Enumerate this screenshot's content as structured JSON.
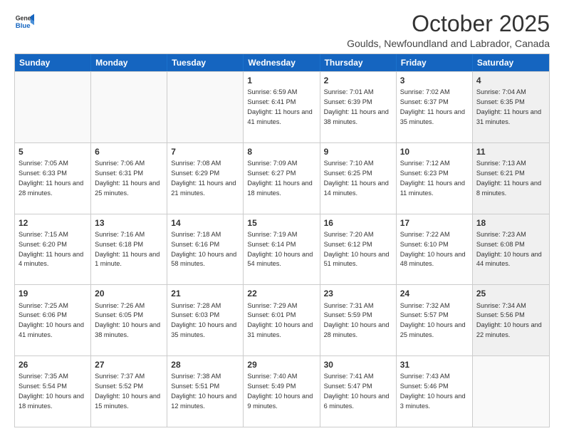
{
  "logo": {
    "general": "General",
    "blue": "Blue"
  },
  "title": "October 2025",
  "subtitle": "Goulds, Newfoundland and Labrador, Canada",
  "days": [
    "Sunday",
    "Monday",
    "Tuesday",
    "Wednesday",
    "Thursday",
    "Friday",
    "Saturday"
  ],
  "weeks": [
    [
      {
        "day": "",
        "text": "",
        "empty": true
      },
      {
        "day": "",
        "text": "",
        "empty": true
      },
      {
        "day": "",
        "text": "",
        "empty": true
      },
      {
        "day": "1",
        "text": "Sunrise: 6:59 AM\nSunset: 6:41 PM\nDaylight: 11 hours and 41 minutes.",
        "empty": false
      },
      {
        "day": "2",
        "text": "Sunrise: 7:01 AM\nSunset: 6:39 PM\nDaylight: 11 hours and 38 minutes.",
        "empty": false
      },
      {
        "day": "3",
        "text": "Sunrise: 7:02 AM\nSunset: 6:37 PM\nDaylight: 11 hours and 35 minutes.",
        "empty": false
      },
      {
        "day": "4",
        "text": "Sunrise: 7:04 AM\nSunset: 6:35 PM\nDaylight: 11 hours and 31 minutes.",
        "empty": false,
        "shaded": true
      }
    ],
    [
      {
        "day": "5",
        "text": "Sunrise: 7:05 AM\nSunset: 6:33 PM\nDaylight: 11 hours and 28 minutes.",
        "empty": false
      },
      {
        "day": "6",
        "text": "Sunrise: 7:06 AM\nSunset: 6:31 PM\nDaylight: 11 hours and 25 minutes.",
        "empty": false
      },
      {
        "day": "7",
        "text": "Sunrise: 7:08 AM\nSunset: 6:29 PM\nDaylight: 11 hours and 21 minutes.",
        "empty": false
      },
      {
        "day": "8",
        "text": "Sunrise: 7:09 AM\nSunset: 6:27 PM\nDaylight: 11 hours and 18 minutes.",
        "empty": false
      },
      {
        "day": "9",
        "text": "Sunrise: 7:10 AM\nSunset: 6:25 PM\nDaylight: 11 hours and 14 minutes.",
        "empty": false
      },
      {
        "day": "10",
        "text": "Sunrise: 7:12 AM\nSunset: 6:23 PM\nDaylight: 11 hours and 11 minutes.",
        "empty": false
      },
      {
        "day": "11",
        "text": "Sunrise: 7:13 AM\nSunset: 6:21 PM\nDaylight: 11 hours and 8 minutes.",
        "empty": false,
        "shaded": true
      }
    ],
    [
      {
        "day": "12",
        "text": "Sunrise: 7:15 AM\nSunset: 6:20 PM\nDaylight: 11 hours and 4 minutes.",
        "empty": false
      },
      {
        "day": "13",
        "text": "Sunrise: 7:16 AM\nSunset: 6:18 PM\nDaylight: 11 hours and 1 minute.",
        "empty": false
      },
      {
        "day": "14",
        "text": "Sunrise: 7:18 AM\nSunset: 6:16 PM\nDaylight: 10 hours and 58 minutes.",
        "empty": false
      },
      {
        "day": "15",
        "text": "Sunrise: 7:19 AM\nSunset: 6:14 PM\nDaylight: 10 hours and 54 minutes.",
        "empty": false
      },
      {
        "day": "16",
        "text": "Sunrise: 7:20 AM\nSunset: 6:12 PM\nDaylight: 10 hours and 51 minutes.",
        "empty": false
      },
      {
        "day": "17",
        "text": "Sunrise: 7:22 AM\nSunset: 6:10 PM\nDaylight: 10 hours and 48 minutes.",
        "empty": false
      },
      {
        "day": "18",
        "text": "Sunrise: 7:23 AM\nSunset: 6:08 PM\nDaylight: 10 hours and 44 minutes.",
        "empty": false,
        "shaded": true
      }
    ],
    [
      {
        "day": "19",
        "text": "Sunrise: 7:25 AM\nSunset: 6:06 PM\nDaylight: 10 hours and 41 minutes.",
        "empty": false
      },
      {
        "day": "20",
        "text": "Sunrise: 7:26 AM\nSunset: 6:05 PM\nDaylight: 10 hours and 38 minutes.",
        "empty": false
      },
      {
        "day": "21",
        "text": "Sunrise: 7:28 AM\nSunset: 6:03 PM\nDaylight: 10 hours and 35 minutes.",
        "empty": false
      },
      {
        "day": "22",
        "text": "Sunrise: 7:29 AM\nSunset: 6:01 PM\nDaylight: 10 hours and 31 minutes.",
        "empty": false
      },
      {
        "day": "23",
        "text": "Sunrise: 7:31 AM\nSunset: 5:59 PM\nDaylight: 10 hours and 28 minutes.",
        "empty": false
      },
      {
        "day": "24",
        "text": "Sunrise: 7:32 AM\nSunset: 5:57 PM\nDaylight: 10 hours and 25 minutes.",
        "empty": false
      },
      {
        "day": "25",
        "text": "Sunrise: 7:34 AM\nSunset: 5:56 PM\nDaylight: 10 hours and 22 minutes.",
        "empty": false,
        "shaded": true
      }
    ],
    [
      {
        "day": "26",
        "text": "Sunrise: 7:35 AM\nSunset: 5:54 PM\nDaylight: 10 hours and 18 minutes.",
        "empty": false
      },
      {
        "day": "27",
        "text": "Sunrise: 7:37 AM\nSunset: 5:52 PM\nDaylight: 10 hours and 15 minutes.",
        "empty": false
      },
      {
        "day": "28",
        "text": "Sunrise: 7:38 AM\nSunset: 5:51 PM\nDaylight: 10 hours and 12 minutes.",
        "empty": false
      },
      {
        "day": "29",
        "text": "Sunrise: 7:40 AM\nSunset: 5:49 PM\nDaylight: 10 hours and 9 minutes.",
        "empty": false
      },
      {
        "day": "30",
        "text": "Sunrise: 7:41 AM\nSunset: 5:47 PM\nDaylight: 10 hours and 6 minutes.",
        "empty": false
      },
      {
        "day": "31",
        "text": "Sunrise: 7:43 AM\nSunset: 5:46 PM\nDaylight: 10 hours and 3 minutes.",
        "empty": false
      },
      {
        "day": "",
        "text": "",
        "empty": true,
        "shaded": true
      }
    ]
  ]
}
